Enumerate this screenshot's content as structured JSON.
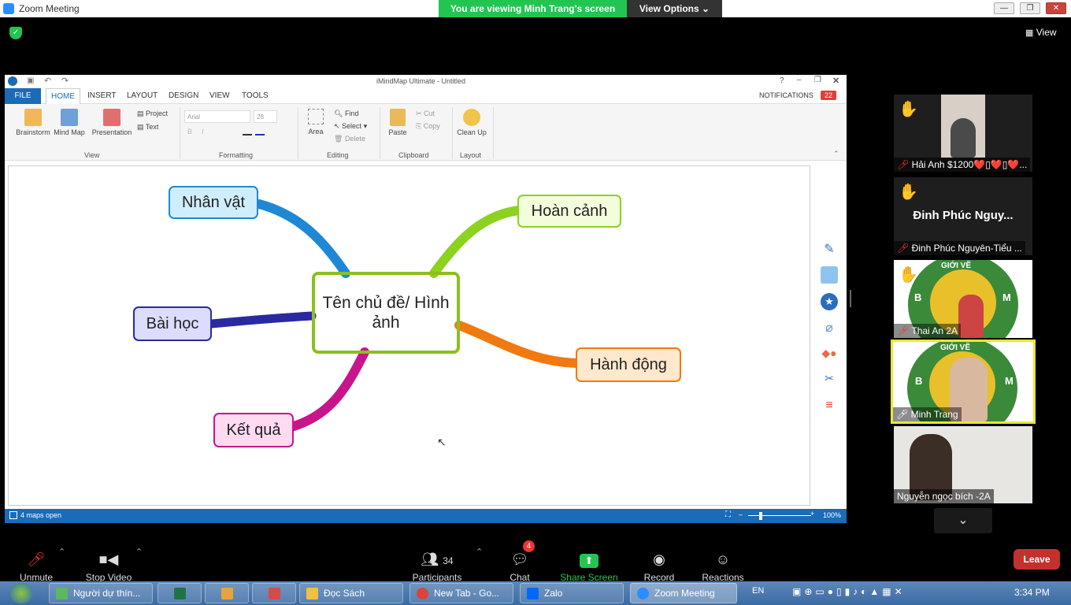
{
  "zoom": {
    "window_title": "Zoom Meeting",
    "viewing_banner": "You are viewing Minh Trang's screen",
    "view_options": "View Options",
    "view_button": "View",
    "window_buttons": [
      "—",
      "❐",
      "✕"
    ]
  },
  "imindmap": {
    "window_title": "iMindMap Ultimate - Untitled",
    "tabs": [
      "FILE",
      "HOME",
      "INSERT",
      "LAYOUT",
      "DESIGN",
      "VIEW",
      "TOOLS"
    ],
    "notifications_label": "NOTIFICATIONS",
    "notifications_count": "22",
    "ribbon": {
      "view_group": {
        "label": "View",
        "buttons": [
          "Brainstorm",
          "Mind Map",
          "Presentation",
          "Project",
          "Text"
        ]
      },
      "formatting_group": {
        "label": "Formatting",
        "font": "Arial",
        "size": "28"
      },
      "editing_group": {
        "label": "Editing",
        "buttons": [
          "Area",
          "Find",
          "Select",
          "Delete"
        ]
      },
      "clipboard_group": {
        "label": "Clipboard",
        "buttons": [
          "Paste",
          "Cut",
          "Copy"
        ]
      },
      "layout_group": {
        "label": "Layout",
        "buttons": [
          "Clean Up"
        ]
      }
    },
    "status_left": "4 maps open",
    "zoom_level": "100%",
    "mindmap": {
      "central": "Tên chủ đề/ Hình ảnh",
      "branches": [
        {
          "label": "Nhân vật",
          "color": "#1e88d6"
        },
        {
          "label": "Hoàn cảnh",
          "color": "#8cd21e"
        },
        {
          "label": "Bài học",
          "color": "#2a2aa0"
        },
        {
          "label": "Hành động",
          "color": "#f07a10"
        },
        {
          "label": "Kết quả",
          "color": "#c8158c"
        }
      ]
    }
  },
  "participants_panel": [
    {
      "name": "Hải Anh $1200❤️▯❤️▯❤️...",
      "hand_raised": true,
      "muted": true
    },
    {
      "name": "Đinh Phúc Nguyên-Tiểu ...",
      "display_name": "Đinh Phúc Nguy...",
      "hand_raised": true,
      "muted": true
    },
    {
      "name": "Thai An 2A",
      "hand_raised": true,
      "muted": true,
      "badge_letters": [
        "B",
        "M"
      ],
      "badge_text": "GIỚI VẼ"
    },
    {
      "name": "Minh Trang",
      "hand_raised": false,
      "muted": false,
      "active_speaker": true,
      "badge_letters": [
        "B",
        "M"
      ],
      "badge_text": "GIỚI VẼ"
    },
    {
      "name": "Nguyễn ngọc bích -2A",
      "hand_raised": false,
      "muted": false
    }
  ],
  "toolbar": {
    "unmute": "Unmute",
    "stop_video": "Stop Video",
    "participants": "Participants",
    "participants_count": "34",
    "chat": "Chat",
    "chat_badge": "4",
    "share_screen": "Share Screen",
    "record": "Record",
    "reactions": "Reactions",
    "leave": "Leave"
  },
  "taskbar": {
    "items": [
      {
        "label": "Người dự thín...",
        "active": false
      },
      {
        "label": "",
        "active": false
      },
      {
        "label": "",
        "active": false
      },
      {
        "label": "",
        "active": false
      },
      {
        "label": "Đọc Sách",
        "active": false
      },
      {
        "label": "New Tab - Go...",
        "active": false
      },
      {
        "label": "Zalo",
        "active": false
      },
      {
        "label": "Zoom Meeting",
        "active": true
      }
    ],
    "language": "EN",
    "clock": "3:34 PM"
  }
}
